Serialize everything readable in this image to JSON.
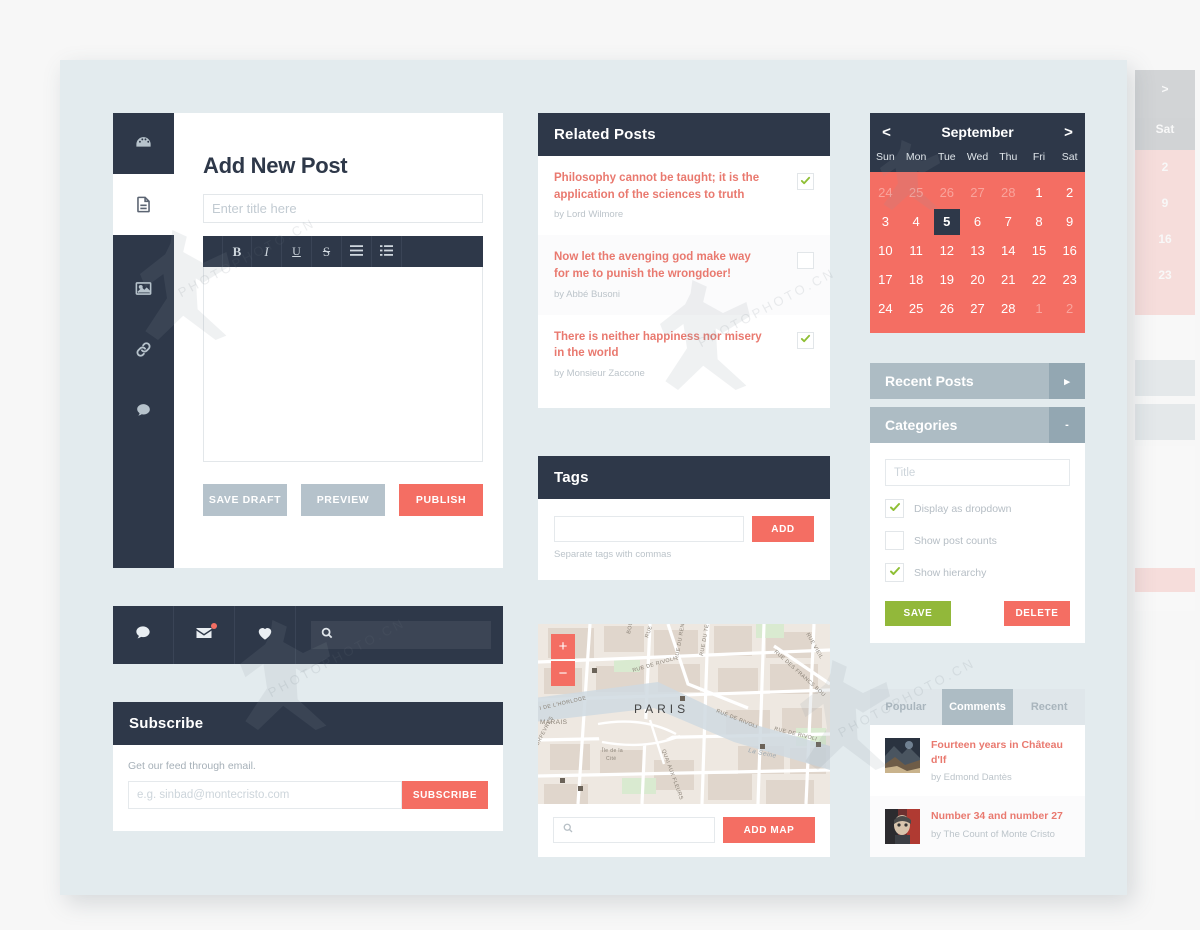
{
  "sidebar": {
    "items": [
      {
        "name": "dashboard",
        "icon": "gauge-icon",
        "active": false
      },
      {
        "name": "posts",
        "icon": "document-icon",
        "active": true
      },
      {
        "name": "media",
        "icon": "image-icon",
        "active": false
      },
      {
        "name": "links",
        "icon": "link-icon",
        "active": false
      },
      {
        "name": "comments",
        "icon": "comment-icon",
        "active": false
      }
    ]
  },
  "editor": {
    "page_title": "Add New Post",
    "title_placeholder": "Enter title here",
    "title_value": "",
    "toolbar": [
      {
        "label": "B",
        "name": "bold"
      },
      {
        "label": "I",
        "name": "italic"
      },
      {
        "label": "U",
        "name": "underline"
      },
      {
        "label": "S",
        "name": "strikethrough"
      },
      {
        "label": "",
        "name": "unordered-list"
      },
      {
        "label": "",
        "name": "ordered-list"
      }
    ],
    "content": "",
    "save_draft_label": "SAVE DRAFT",
    "preview_label": "PREVIEW",
    "publish_label": "PUBLISH"
  },
  "icon_strip": {
    "icons": [
      "comment-icon",
      "mail-icon",
      "heart-icon"
    ],
    "mail_has_badge": true,
    "search_value": "",
    "search_placeholder": ""
  },
  "subscribe": {
    "title": "Subscribe",
    "hint": "Get our feed through email.",
    "placeholder": "e.g. sinbad@montecristo.com",
    "value": "",
    "button_label": "SUBSCRIBE"
  },
  "related_posts": {
    "title": "Related Posts",
    "items": [
      {
        "title": "Philosophy cannot be taught; it is the application of the sciences to truth",
        "author": "by Lord Wilmore",
        "checked": true
      },
      {
        "title": "Now let the avenging god make way for me to punish the wrongdoer!",
        "author": "by Abbé Busoni",
        "checked": false
      },
      {
        "title": "There is neither happiness nor misery in the world",
        "author": "by Monsieur Zaccone",
        "checked": true
      }
    ]
  },
  "tags": {
    "title": "Tags",
    "input_value": "",
    "input_placeholder": "",
    "add_label": "ADD",
    "hint": "Separate tags with commas"
  },
  "map": {
    "city_label": "PARIS",
    "zoom_in": "+",
    "zoom_out": "−",
    "street_labels": [
      "RUE QU",
      "BOULE",
      "RUE DU RENARD",
      "RUE DU TEMPLE",
      "RUE DES FRANCS BOU",
      "RUE VIEIL",
      "RUE DE RIVOLI",
      "RUE DE RIVOLI",
      "QUAI DE L'HORLOGE",
      "MARAIS",
      "ORFEVRES",
      "QUAI AUX FLEURS",
      "Île de la Cité",
      "La Seine",
      "RIVOLI"
    ],
    "search_value": "",
    "search_placeholder": "",
    "add_label": "ADD MAP"
  },
  "calendar": {
    "month": "September",
    "prev": "<",
    "next": ">",
    "dows": [
      "Sun",
      "Mon",
      "Tue",
      "Wed",
      "Thu",
      "Fri",
      "Sat"
    ],
    "selected_day": 5,
    "weeks": [
      [
        {
          "d": 24,
          "mute": true
        },
        {
          "d": 25,
          "mute": true
        },
        {
          "d": 26,
          "mute": true
        },
        {
          "d": 27,
          "mute": true
        },
        {
          "d": 28,
          "mute": true
        },
        {
          "d": 1,
          "mute": false
        },
        {
          "d": 2,
          "mute": false
        }
      ],
      [
        {
          "d": 3,
          "mute": false
        },
        {
          "d": 4,
          "mute": false
        },
        {
          "d": 5,
          "mute": false,
          "sel": true
        },
        {
          "d": 6,
          "mute": false
        },
        {
          "d": 7,
          "mute": false
        },
        {
          "d": 8,
          "mute": false
        },
        {
          "d": 9,
          "mute": false
        }
      ],
      [
        {
          "d": 10,
          "mute": false
        },
        {
          "d": 11,
          "mute": false
        },
        {
          "d": 12,
          "mute": false
        },
        {
          "d": 13,
          "mute": false
        },
        {
          "d": 14,
          "mute": false
        },
        {
          "d": 15,
          "mute": false
        },
        {
          "d": 16,
          "mute": false
        }
      ],
      [
        {
          "d": 17,
          "mute": false
        },
        {
          "d": 18,
          "mute": false
        },
        {
          "d": 19,
          "mute": false
        },
        {
          "d": 20,
          "mute": false
        },
        {
          "d": 21,
          "mute": false
        },
        {
          "d": 22,
          "mute": false
        },
        {
          "d": 23,
          "mute": false
        }
      ],
      [
        {
          "d": 24,
          "mute": false
        },
        {
          "d": 25,
          "mute": false
        },
        {
          "d": 26,
          "mute": false
        },
        {
          "d": 27,
          "mute": false
        },
        {
          "d": 28,
          "mute": false
        },
        {
          "d": 1,
          "mute": true
        },
        {
          "d": 2,
          "mute": true
        }
      ]
    ]
  },
  "recent_posts_accordion": {
    "title": "Recent Posts",
    "toggle": "▸",
    "expanded": false
  },
  "categories_accordion": {
    "title": "Categories",
    "toggle": "-",
    "expanded": true,
    "title_placeholder": "Title",
    "title_value": "",
    "options": [
      {
        "label": "Display as dropdown",
        "checked": true
      },
      {
        "label": "Show post counts",
        "checked": false
      },
      {
        "label": "Show hierarchy",
        "checked": true
      }
    ],
    "save_label": "SAVE",
    "delete_label": "DELETE"
  },
  "tabs_panel": {
    "tabs": [
      {
        "label": "Popular",
        "active": false
      },
      {
        "label": "Comments",
        "active": true
      },
      {
        "label": "Recent",
        "active": false
      }
    ],
    "items": [
      {
        "title": "Fourteen years in Château d'If",
        "author": "by Edmond Dantès"
      },
      {
        "title": "Number 34 and number 27",
        "author": "by The Count of Monte Cristo"
      }
    ]
  },
  "ghost_layer": {
    "next_label": ">",
    "sat_label": "Sat",
    "days": [
      "2",
      "9",
      "16",
      "23"
    ]
  },
  "watermark": {
    "text": "PHOTOPHOTO.CN"
  },
  "colors": {
    "dark": "#2e3849",
    "coral": "#f46e63",
    "grey_blue": "#adbcc4",
    "grey_blue_dark": "#93a7b2",
    "green": "#92b83a",
    "canvas": "#e3ebee",
    "btn_grey": "#b5c2cb",
    "title_red": "#e9796f"
  }
}
